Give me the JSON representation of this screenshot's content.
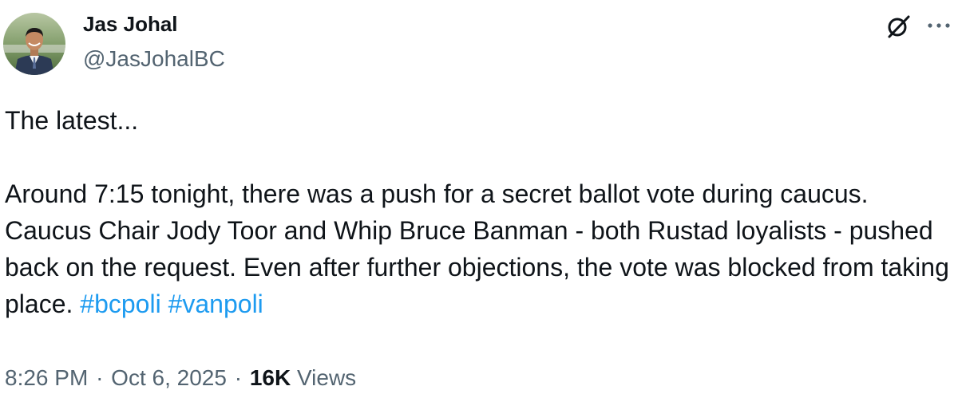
{
  "author": {
    "name": "Jas Johal",
    "handle": "@JasJohalBC"
  },
  "tweet": {
    "intro": "The latest...",
    "body": "Around 7:15 tonight, there was a push for a secret ballot vote during caucus. Caucus Chair Jody Toor and Whip Bruce Banman - both Rustad loyalists - pushed back on the request. Even after further objections, the vote was blocked from taking place.",
    "hashtags": [
      "#bcpoli",
      "#vanpoli"
    ]
  },
  "meta": {
    "time": "8:26 PM",
    "separator": "·",
    "date": "Oct 6, 2025",
    "views_count": "16K",
    "views_label": "Views"
  },
  "icons": {
    "grok": "grok-slash-circle-icon",
    "more": "more-horizontal-icon"
  },
  "colors": {
    "text": "#0f1419",
    "secondary": "#536471",
    "link": "#1d9bf0"
  }
}
